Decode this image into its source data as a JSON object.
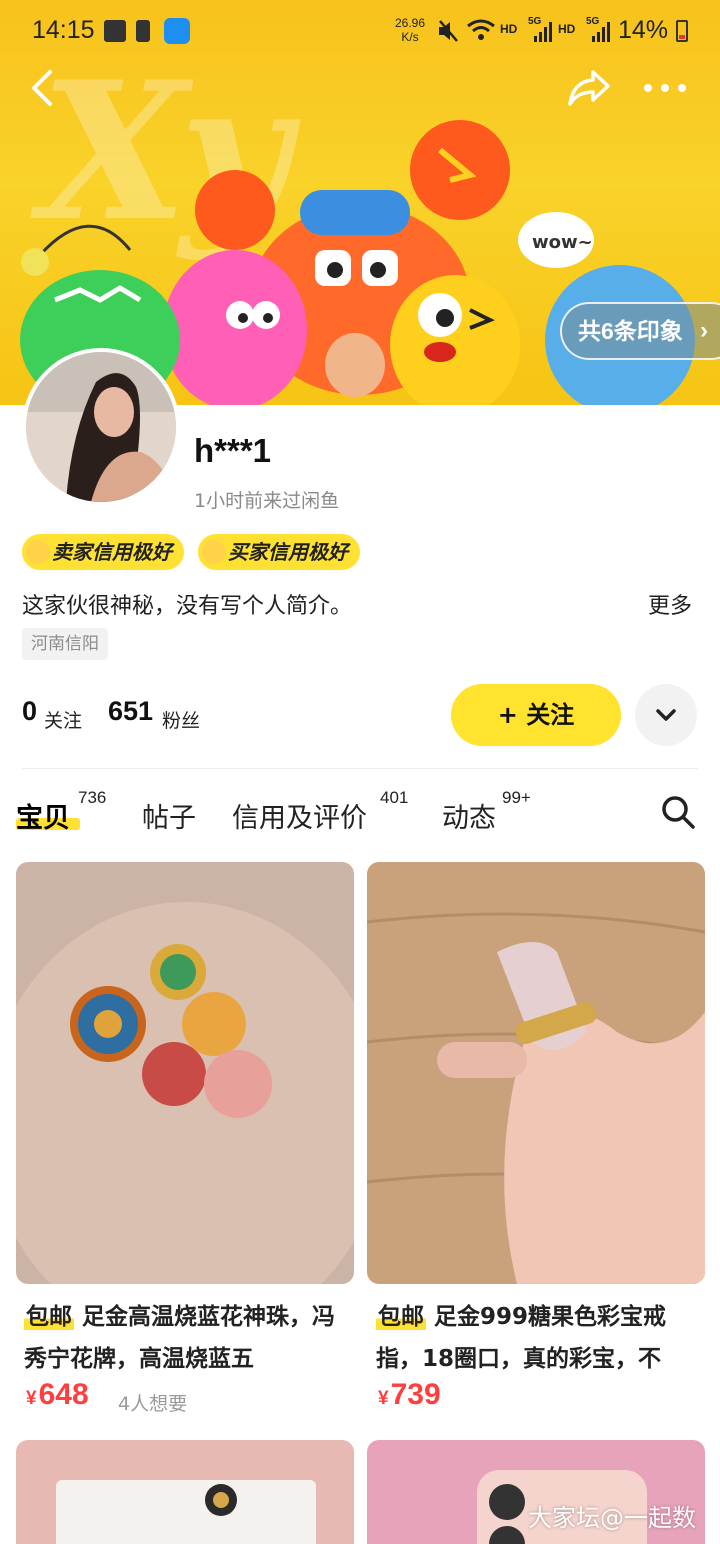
{
  "status_bar": {
    "time": "14:15",
    "speed": "26.96",
    "speed_unit": "K/s",
    "hd1": "HD",
    "net1": "5G",
    "hd2": "HD",
    "net2": "5G",
    "battery": "14%"
  },
  "header": {
    "impressions": "共6条印象"
  },
  "profile": {
    "nickname": "h***1",
    "last_seen": "1小时前来过闲鱼",
    "badges": [
      "卖家信用极好",
      "买家信用极好"
    ],
    "bio": "这家伙很神秘，没有写个人简介。",
    "bio_more": "更多",
    "location": "河南信阳",
    "following_count": "0",
    "following_label": "关注",
    "fans_count": "651",
    "fans_label": "粉丝",
    "follow_button": "+ 关注"
  },
  "tabs": [
    {
      "label": "宝贝",
      "count": "736"
    },
    {
      "label": "帖子",
      "count": ""
    },
    {
      "label": "信用及评价",
      "count": "401"
    },
    {
      "label": "动态",
      "count": "99+"
    }
  ],
  "products": [
    {
      "tag": "包邮",
      "title": "足金高温烧蓝花神珠，冯秀宁花牌，高温烧蓝五",
      "currency": "¥",
      "price": "648",
      "want": "4人想要"
    },
    {
      "tag": "包邮",
      "title": "足金999糖果色彩宝戒指，18圈口，真的彩宝，不",
      "currency": "¥",
      "price": "739",
      "want": ""
    }
  ],
  "watermark": "大家坛@一起数",
  "colors": {
    "accent_yellow": "#ffe133",
    "price_red": "#ff3f3f",
    "banner_yellow": "#f7c21c"
  }
}
